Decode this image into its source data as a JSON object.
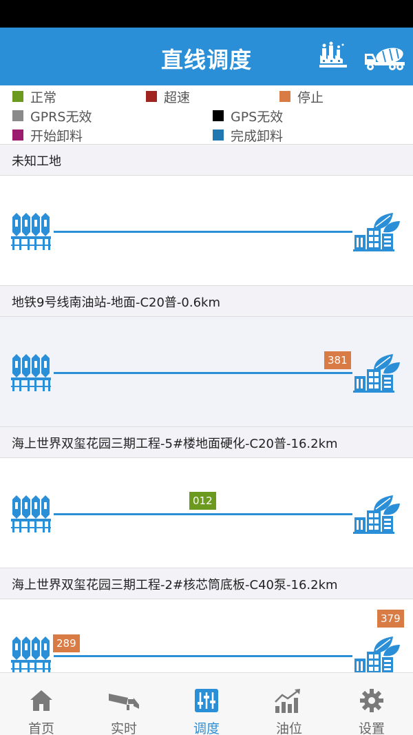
{
  "app_bar": {
    "title": "直线调度",
    "factory_icon": "factory-icon",
    "truck_icon": "mixer-truck-icon"
  },
  "legend": [
    {
      "label": "正常",
      "color": "#6b9a1f"
    },
    {
      "label": "超速",
      "color": "#a02420"
    },
    {
      "label": "停止",
      "color": "#d97b45"
    },
    {
      "label": "GPRS无效",
      "color": "#8a8a8a"
    },
    {
      "label": "GPS无效",
      "color": "#000000"
    },
    {
      "label": "开始卸料",
      "color": "#9b1b6e"
    },
    {
      "label": "完成卸料",
      "color": "#1f78b0"
    }
  ],
  "sites": [
    {
      "name": "未知工地",
      "trucks": []
    },
    {
      "name": "地铁9号线南油站-地面-C20普-0.6km",
      "trucks": [
        {
          "id": "381",
          "status": "停止"
        }
      ]
    },
    {
      "name": "海上世界双玺花园三期工程-5#楼地面硬化-C20普-16.2km",
      "trucks": [
        {
          "id": "012",
          "status": "正常"
        }
      ]
    },
    {
      "name": "海上世界双玺花园三期工程-2#核芯筒底板-C40泵-16.2km",
      "trucks": [
        {
          "id": "289",
          "status": "停止"
        },
        {
          "id": "379",
          "status": "停止"
        }
      ]
    }
  ],
  "bottom_nav": [
    {
      "label": "首页",
      "icon": "home-icon",
      "active": false
    },
    {
      "label": "实时",
      "icon": "camera-icon",
      "active": false
    },
    {
      "label": "调度",
      "icon": "dispatch-icon",
      "active": true
    },
    {
      "label": "油位",
      "icon": "chart-icon",
      "active": false
    },
    {
      "label": "设置",
      "icon": "gear-icon",
      "active": false
    }
  ],
  "colors": {
    "primary": "#2b8fd8",
    "status_bar": "#000000",
    "stop": "#d97b45",
    "normal": "#6b9a1f"
  }
}
